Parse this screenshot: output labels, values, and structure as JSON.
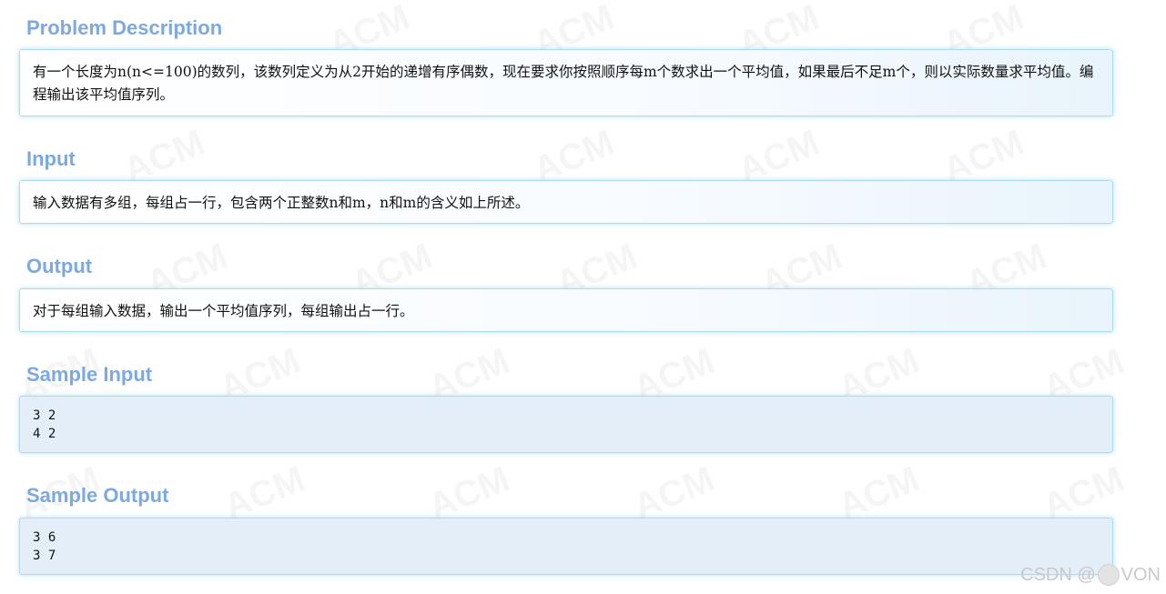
{
  "sections": {
    "description": {
      "title": "Problem Description",
      "text": "有一个长度为n(n<=100)的数列，该数列定义为从2开始的递增有序偶数，现在要求你按照顺序每m个数求出一个平均值，如果最后不足m个，则以实际数量求平均值。编程输出该平均值序列。"
    },
    "input": {
      "title": "Input",
      "text": "输入数据有多组，每组占一行，包含两个正整数n和m，n和m的含义如上所述。"
    },
    "output": {
      "title": "Output",
      "text": "对于每组输入数据，输出一个平均值序列，每组输出占一行。"
    },
    "sample_input": {
      "title": "Sample Input",
      "lines": [
        "3 2",
        "4 2"
      ]
    },
    "sample_output": {
      "title": "Sample Output",
      "lines": [
        "3 6",
        "3 7"
      ]
    }
  },
  "watermark": {
    "text": "ACM"
  },
  "footer": {
    "left": "CSDN @",
    "right": "VON"
  },
  "colors": {
    "heading": "#7ca9e0",
    "panel_border": "#a9dcf2",
    "code_background": "#e4eef8"
  }
}
